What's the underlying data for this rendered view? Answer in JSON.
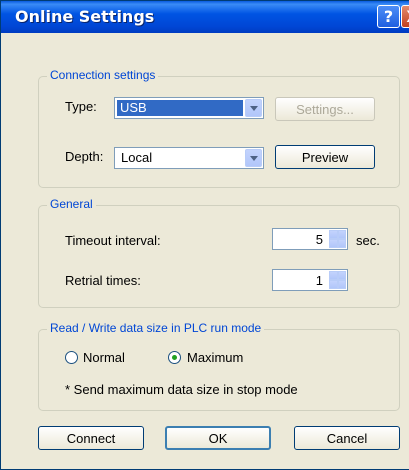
{
  "window": {
    "title": "Online Settings",
    "help_glyph": "?",
    "close_glyph": "X"
  },
  "connection": {
    "group_label": "Connection settings",
    "type_label": "Type:",
    "type_value": "USB",
    "settings_button": "Settings...",
    "depth_label": "Depth:",
    "depth_value": "Local",
    "preview_button": "Preview"
  },
  "general": {
    "group_label": "General",
    "timeout_label": "Timeout interval:",
    "timeout_value": "5",
    "timeout_unit": "sec.",
    "retrial_label": "Retrial times:",
    "retrial_value": "1"
  },
  "readwrite": {
    "group_label": "Read / Write data size in PLC run mode",
    "normal_label": "Normal",
    "maximum_label": "Maximum",
    "selected": "Maximum",
    "note": "* Send maximum data size in stop mode"
  },
  "buttons": {
    "connect": "Connect",
    "ok": "OK",
    "cancel": "Cancel"
  }
}
